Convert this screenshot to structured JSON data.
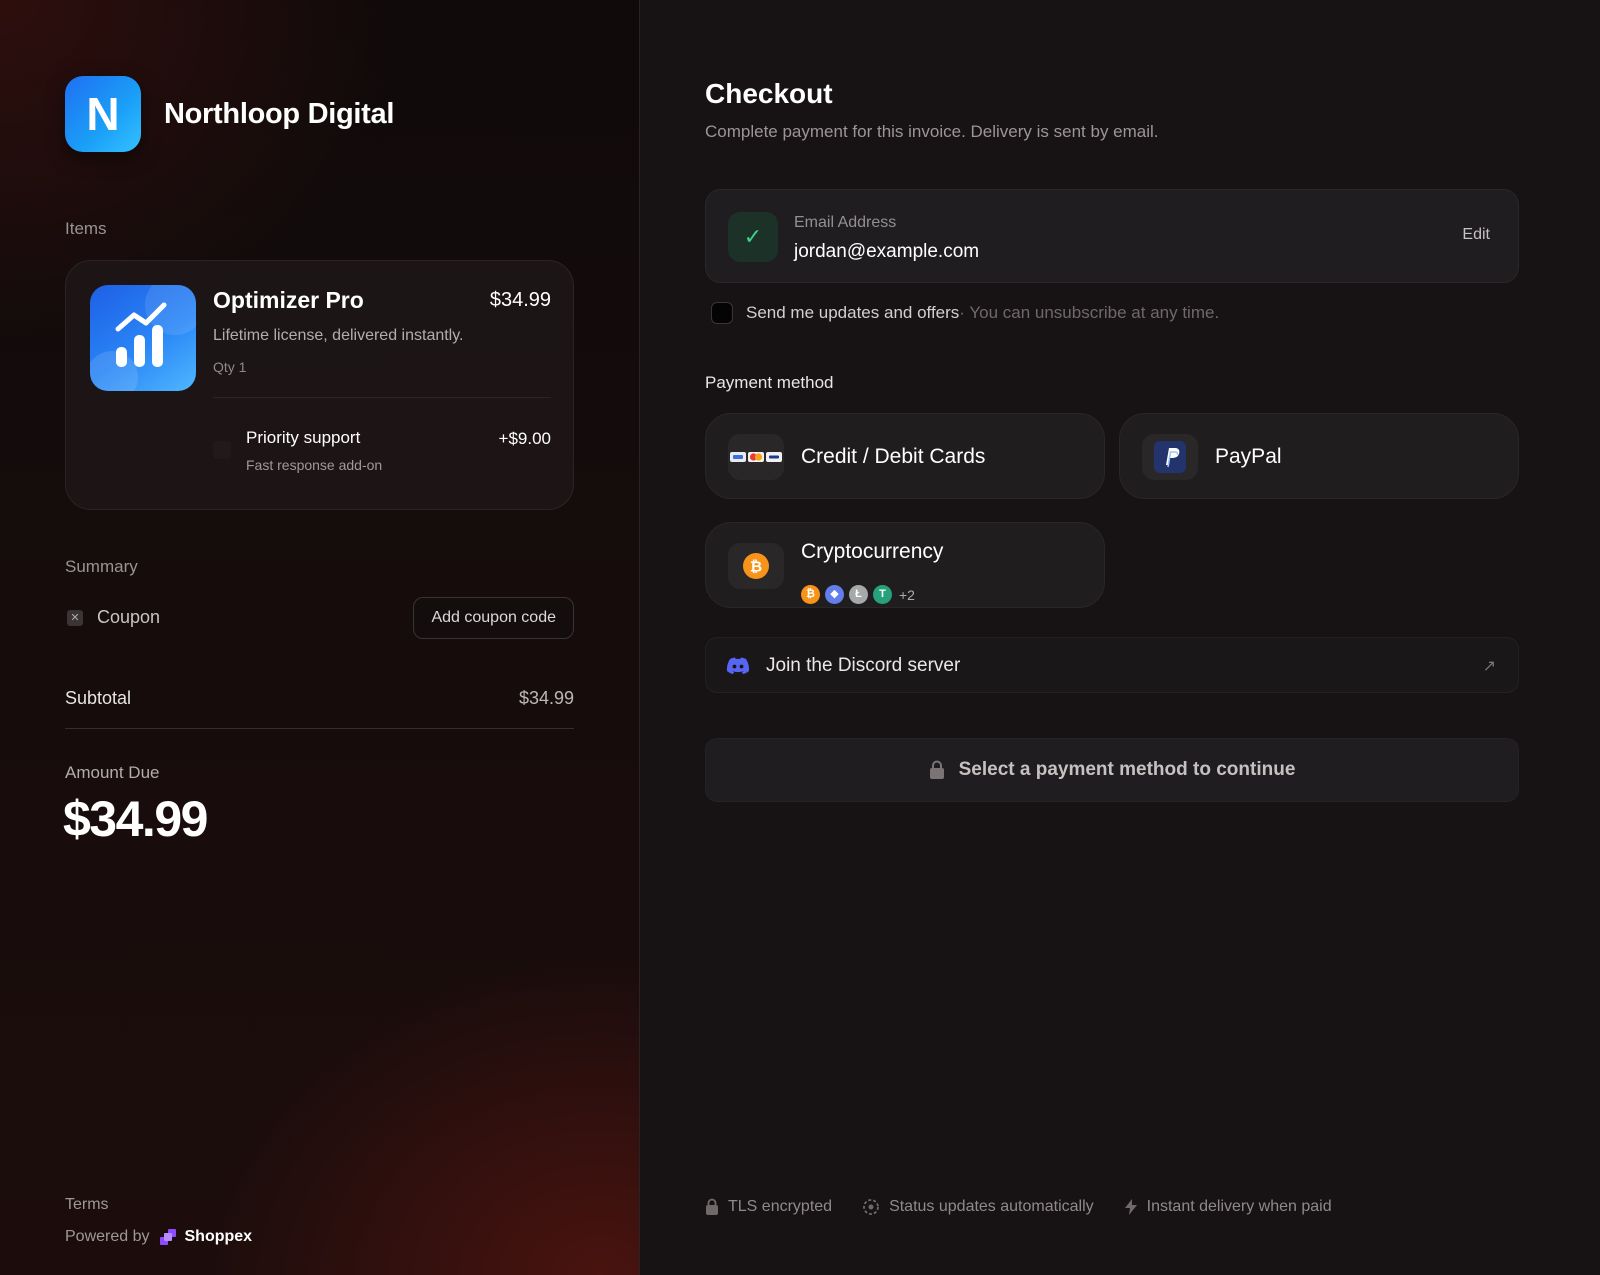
{
  "brand": {
    "logo_letter": "N",
    "name": "Northloop Digital",
    "accent": "#1a8cf5"
  },
  "items_section": {
    "label": "Items"
  },
  "item": {
    "name": "Optimizer Pro",
    "price": "$34.99",
    "description": "Lifetime license, delivered instantly.",
    "qty": "Qty 1",
    "addon": {
      "name": "Priority support",
      "description": "Fast response add-on",
      "price": "+$9.00",
      "checked": false
    }
  },
  "summary": {
    "label": "Summary",
    "coupon_label": "Coupon",
    "coupon_button": "Add coupon code",
    "subtotal_label": "Subtotal",
    "subtotal_value": "$34.99",
    "amount_due_label": "Amount Due",
    "amount_due_value": "$34.99"
  },
  "left_footer": {
    "terms": "Terms",
    "powered_by": "Powered by",
    "provider": "Shoppex"
  },
  "checkout": {
    "title": "Checkout",
    "subtitle": "Complete payment for this invoice. Delivery is sent by email.",
    "email": {
      "label": "Email Address",
      "value": "jordan@example.com",
      "edit": "Edit",
      "verified_icon": "check-icon"
    },
    "updates": {
      "label": "Send me updates and offers",
      "note": " · You can unsubscribe at any time.",
      "checked": false
    },
    "payment_method_label": "Payment method",
    "methods": [
      {
        "name": "Credit / Debit Cards",
        "icon": "cards-icon"
      },
      {
        "name": "PayPal",
        "icon": "paypal-icon"
      },
      {
        "name": "Cryptocurrency",
        "icon": "bitcoin-icon",
        "extra_count": "+2"
      }
    ],
    "discord": {
      "label": "Join the Discord server",
      "icon": "discord-icon"
    },
    "continue_button": "Select a payment method to continue"
  },
  "right_footer": {
    "items": [
      "TLS encrypted",
      "Status updates automatically",
      "Instant delivery when paid"
    ]
  }
}
